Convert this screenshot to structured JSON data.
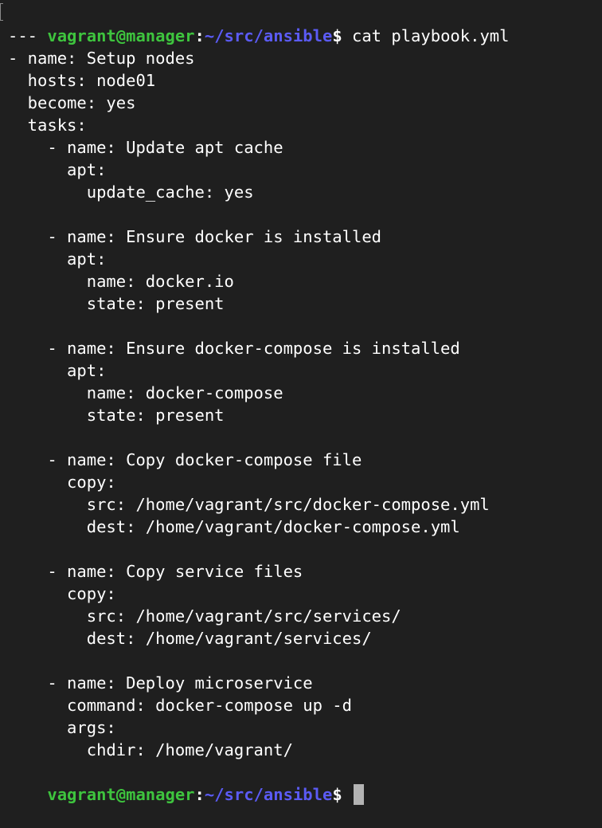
{
  "prompt": {
    "user_host": "vagrant@manager",
    "colon": ":",
    "path": "~/src/ansible",
    "dollar": "$"
  },
  "command": " cat playbook.yml",
  "output_lines": [
    "---",
    "- name: Setup nodes",
    "  hosts: node01",
    "  become: yes",
    "  tasks:",
    "    - name: Update apt cache",
    "      apt:",
    "        update_cache: yes",
    "",
    "    - name: Ensure docker is installed",
    "      apt:",
    "        name: docker.io",
    "        state: present",
    "",
    "    - name: Ensure docker-compose is installed",
    "      apt:",
    "        name: docker-compose",
    "        state: present",
    "",
    "    - name: Copy docker-compose file",
    "      copy:",
    "        src: /home/vagrant/src/docker-compose.yml",
    "        dest: /home/vagrant/docker-compose.yml",
    "",
    "    - name: Copy service files",
    "      copy:",
    "        src: /home/vagrant/src/services/",
    "        dest: /home/vagrant/services/",
    "",
    "    - name: Deploy microservice",
    "      command: docker-compose up -d",
    "      args:",
    "        chdir: /home/vagrant/"
  ]
}
